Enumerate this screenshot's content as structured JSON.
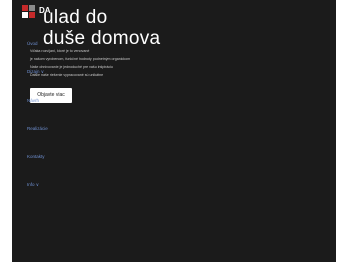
{
  "brand": {
    "logo_text": "DA",
    "colors": {
      "red": "#c62a2a",
      "gray": "#8a8a8a",
      "white": "#ffffff",
      "accent_link": "#6e8fd0"
    }
  },
  "hero": {
    "headline_line1": "ulad do",
    "headline_line2": "duše domova",
    "description_lines": [
      "Vďaka rozvíjaní, ktoré je to venované",
      "je našom vyrobenom, funkčné hodnoty podnetným organickom",
      "Naše ohnivovanie je jednoduché pre vašu inšpiráciu",
      "Ďalšie naše riešenie vypracované sú unikátne"
    ],
    "cta_label": "Objavte viac"
  },
  "nav": {
    "items": [
      {
        "label": "Úvod"
      },
      {
        "label": "Dizajn ∨"
      },
      {
        "label": "Návrh"
      },
      {
        "label": "Realizácie"
      },
      {
        "label": "Kontakty"
      },
      {
        "label": "Info ∨"
      }
    ]
  }
}
